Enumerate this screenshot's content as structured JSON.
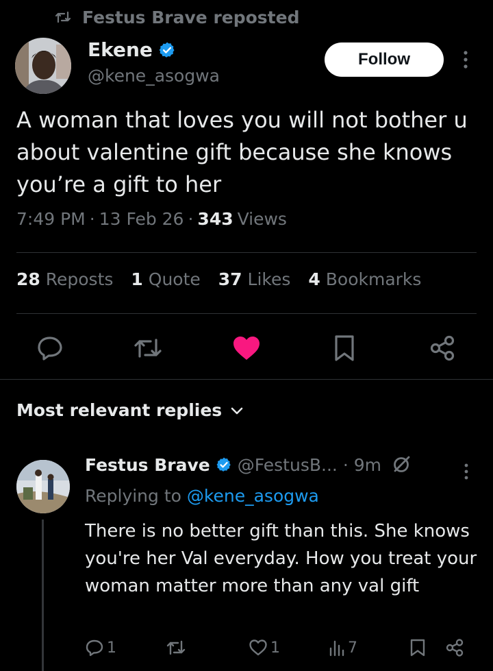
{
  "repost": {
    "text": "Festus Brave reposted",
    "icon": "repost-icon"
  },
  "tweet": {
    "author_name": "Ekene",
    "author_handle": "@kene_asogwa",
    "follow_label": "Follow",
    "text": "A woman that loves you will not bother u about valentine gift because she knows you’re a gift to her",
    "time": "7:49 PM",
    "date": "13 Feb 26",
    "views_count": "343",
    "views_label": "Views",
    "separator": "·"
  },
  "stats": [
    {
      "count": "28",
      "label": "Reposts"
    },
    {
      "count": "1",
      "label": "Quote"
    },
    {
      "count": "37",
      "label": "Likes"
    },
    {
      "count": "4",
      "label": "Bookmarks"
    }
  ],
  "actions": [
    "reply-icon",
    "repost-icon",
    "like-icon",
    "bookmark-icon",
    "share-icon"
  ],
  "replies_header": {
    "label": "Most relevant replies"
  },
  "reply": {
    "author_name": "Festus Brave",
    "author_handle": "@FestusB...",
    "time": "· 9m",
    "replying_prefix": "Replying to",
    "replying_handle": "@kene_asogwa",
    "text": "There is no better gift than this. She knows you're her Val everyday. How you treat your woman matter more than any val gift",
    "reply_count": "1",
    "like_count": "1",
    "view_count": "7"
  },
  "colors": {
    "background": "#000000",
    "text": "#e7e9ea",
    "muted": "#71767b",
    "accent": "#1d9bf0",
    "like": "#f91880",
    "divider": "#2f3336"
  }
}
